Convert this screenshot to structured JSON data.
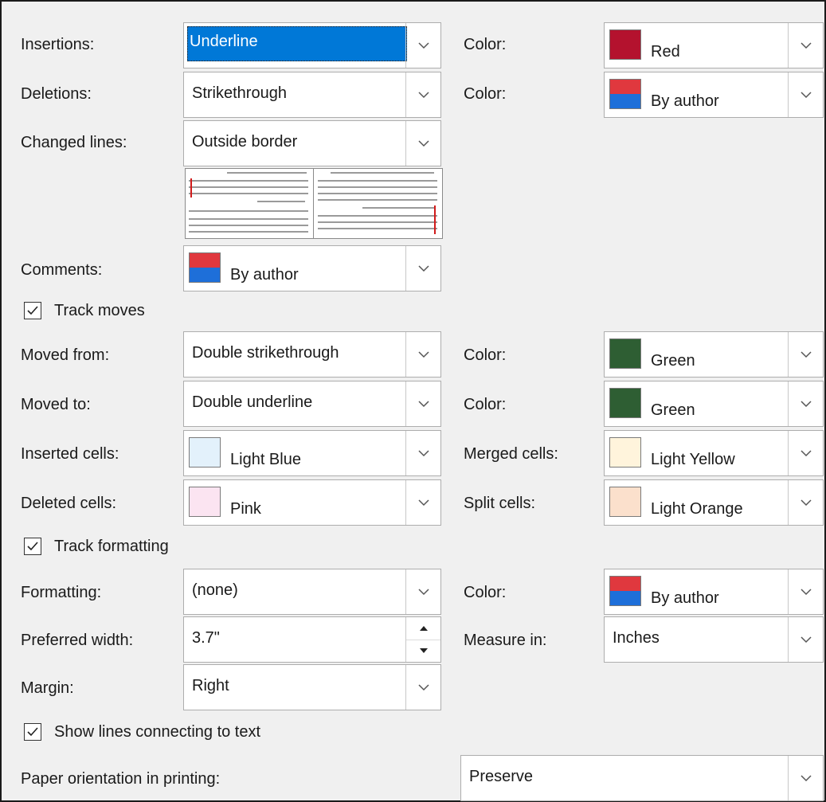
{
  "labels": {
    "insertions": "Insertions:",
    "deletions": "Deletions:",
    "changed_lines": "Changed lines:",
    "comments": "Comments:",
    "moved_from": "Moved from:",
    "moved_to": "Moved to:",
    "inserted_cells": "Inserted cells:",
    "deleted_cells": "Deleted cells:",
    "formatting": "Formatting:",
    "preferred_width": "Preferred width:",
    "margin": "Margin:",
    "paper_orientation": "Paper orientation in printing:",
    "color": "Color:",
    "merged_cells": "Merged cells:",
    "split_cells": "Split cells:",
    "measure_in": "Measure in:"
  },
  "checkboxes": {
    "track_moves": {
      "label": "Track moves",
      "checked": true
    },
    "track_formatting": {
      "label": "Track formatting",
      "checked": true
    },
    "show_lines": {
      "label": "Show lines connecting to text",
      "checked": true
    }
  },
  "values": {
    "insertions": "Underline",
    "deletions": "Strikethrough",
    "changed_lines": "Outside border",
    "comments": "By author",
    "moved_from": "Double strikethrough",
    "moved_to": "Double underline",
    "inserted_cells": "Light Blue",
    "deleted_cells": "Pink",
    "formatting": "(none)",
    "preferred_width": "3.7\"",
    "margin": "Right",
    "paper_orientation": "Preserve",
    "insertions_color": "Red",
    "deletions_color": "By author",
    "moved_from_color": "Green",
    "moved_to_color": "Green",
    "merged_cells": "Light Yellow",
    "split_cells": "Light Orange",
    "formatting_color": "By author",
    "measure_in": "Inches"
  },
  "swatch_colors": {
    "red": "#b4122e",
    "green": "#2e5e33",
    "light_blue": "#e3f1fb",
    "pink": "#fbe4f1",
    "light_yellow": "#fff4dc",
    "light_orange": "#fbe0cc",
    "author_top": "#e0383e",
    "author_bottom": "#1e6fd9",
    "selection": "#0078d7",
    "change_bar": "#d11b1b"
  },
  "icons": {
    "dropdown": "chevron-down-icon",
    "checkbox": "check-icon",
    "spin_up": "triangle-up-icon",
    "spin_down": "triangle-down-icon"
  }
}
